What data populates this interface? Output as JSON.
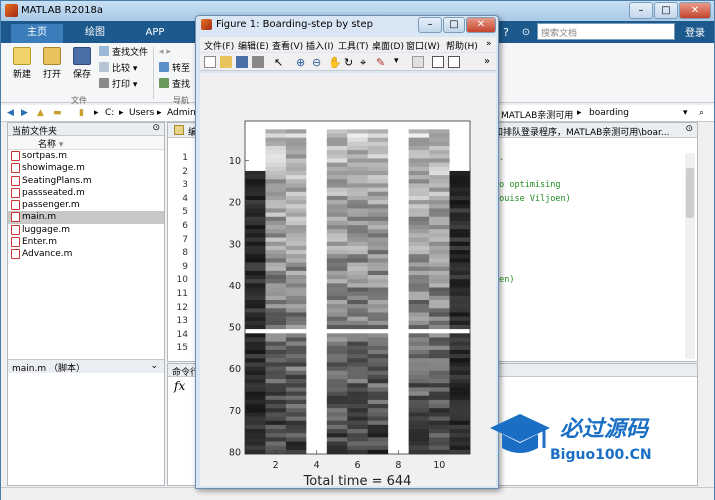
{
  "app": {
    "title": "MATLAB R2018a",
    "search_placeholder": "搜索文档",
    "login": "登录"
  },
  "ribbon": {
    "tabs": [
      "主页",
      "绘图",
      "APP"
    ],
    "big_buttons": [
      "新建",
      "打开",
      "保存"
    ],
    "small_buttons": [
      "查找文件",
      "比较",
      "打印"
    ],
    "nav_buttons": [
      "转至",
      "查找"
    ],
    "groups": [
      "文件",
      "导航"
    ]
  },
  "address": {
    "segments": [
      "C:",
      "Users",
      "Admin"
    ],
    "right": [
      "MATLAB亲测可用",
      "boarding"
    ]
  },
  "current_folder": {
    "title": "当前文件夹",
    "column": "名称",
    "files": [
      "sortpas.m",
      "showimage.m",
      "SeatingPlans.m",
      "passseated.m",
      "passenger.m",
      "main.m",
      "luggage.m",
      "Enter.m",
      "Advance.m"
    ],
    "selected": "main.m",
    "detail": "main.m （脚本）"
  },
  "editor": {
    "path_tail": "和排队登录程序，MATLAB亲测可用\\boar...",
    "tab": "编",
    "line_numbers": [
      "1",
      "2",
      "3",
      "4",
      "5",
      "6",
      "7",
      "8",
      "9",
      "10",
      "11",
      "12",
      "13",
      "14",
      "15"
    ],
    "code": [
      "s.",
      "",
      "to optimising",
      "Louise Viljoen)",
      "",
      "",
      "",
      "",
      "",
      "oen)",
      "",
      "",
      "",
      "",
      ""
    ]
  },
  "command_window": {
    "title": "命令行",
    "prompt": "fx"
  },
  "figure": {
    "title": "Figure 1: Boarding-step by step",
    "menu": [
      "文件(F)",
      "编辑(E)",
      "查看(V)",
      "插入(I)",
      "工具(T)",
      "桌面(D)",
      "窗口(W)",
      "帮助(H)"
    ],
    "xlabel": "Total time = 644",
    "xticks": [
      "2",
      "4",
      "6",
      "8",
      "10"
    ],
    "yticks": [
      "10",
      "20",
      "30",
      "40",
      "50",
      "60",
      "70",
      "80"
    ]
  },
  "watermark": {
    "line1": "必过源码",
    "line2": "Biguo100.CN"
  }
}
